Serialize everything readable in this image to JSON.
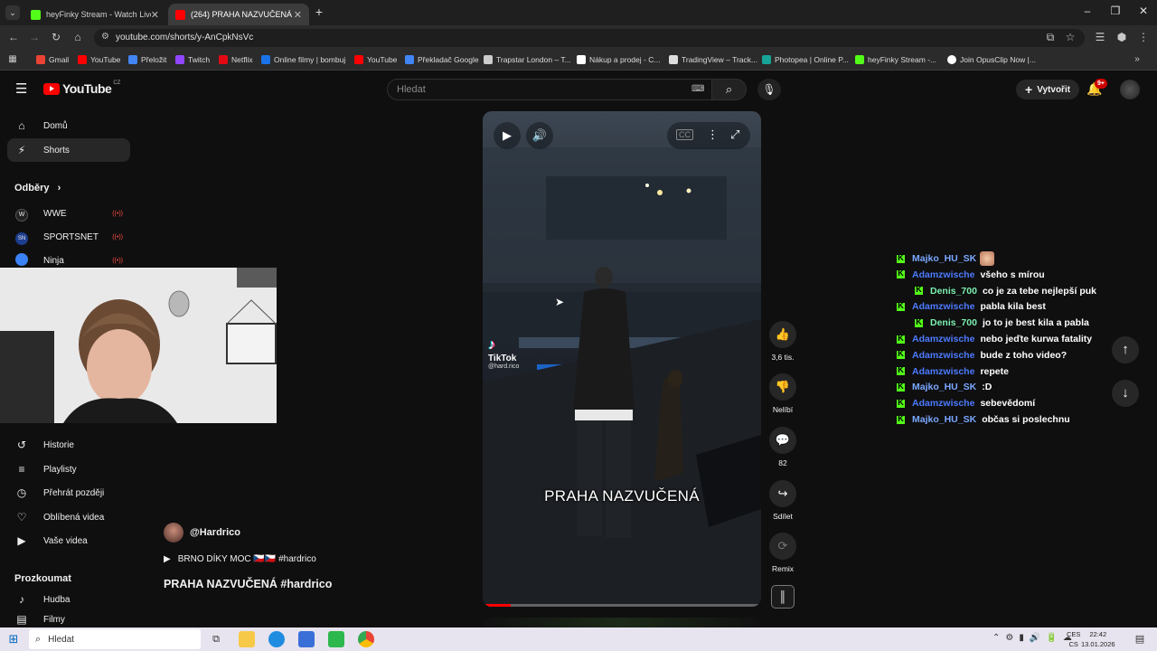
{
  "browser": {
    "tabs": [
      {
        "title": "heyFinky Stream - Watch Live o",
        "color": "#53fc18",
        "active": false
      },
      {
        "title": "(264) PRAHA NAZVUČENÁ #ha",
        "color": "#ff0000",
        "active": true
      }
    ],
    "new_tab": "+",
    "url": "youtube.com/shorts/y-AnCpkNsVc",
    "bookmarks": [
      {
        "label": "Gmail",
        "color": "#ea4335"
      },
      {
        "label": "YouTube",
        "color": "#ff0000"
      },
      {
        "label": "Přeložit",
        "color": "#4285f4"
      },
      {
        "label": "Twitch",
        "color": "#9146ff"
      },
      {
        "label": "Netflix",
        "color": "#e50914"
      },
      {
        "label": "Online filmy | bombuj",
        "color": "#1a73e8"
      },
      {
        "label": "YouTube",
        "color": "#ff0000"
      },
      {
        "label": "Překladač Google",
        "color": "#4285f4"
      },
      {
        "label": "Trapstar London – T...",
        "color": "#cccccc"
      },
      {
        "label": "Nákup a prodej - C...",
        "color": "#ffffff"
      },
      {
        "label": "TradingView – Track...",
        "color": "#dddddd"
      },
      {
        "label": "Photopea | Online P...",
        "color": "#18a497"
      },
      {
        "label": "heyFinky Stream -...",
        "color": "#53fc18"
      },
      {
        "label": "Join OpusClip Now |...",
        "color": "#ffffff"
      }
    ]
  },
  "header": {
    "logo_text": "YouTube",
    "logo_region": "CZ",
    "search_placeholder": "Hledat",
    "create_label": "Vytvořit",
    "notif_count": "9+"
  },
  "sidebar": {
    "top": [
      {
        "label": "Domů",
        "icon": "home-icon",
        "glyph": "⌂"
      },
      {
        "label": "Shorts",
        "icon": "shorts-icon",
        "glyph": "⚡"
      }
    ],
    "subs_heading": "Odběry",
    "subs": [
      {
        "label": "WWE",
        "color": "#222"
      },
      {
        "label": "SPORTSNET",
        "color": "#1d3d8f"
      },
      {
        "label": "Ninja",
        "color": "#3b82f6"
      }
    ],
    "you": [
      {
        "label": "Historie",
        "icon": "history-icon",
        "glyph": "↺"
      },
      {
        "label": "Playlisty",
        "icon": "playlist-icon",
        "glyph": "≡"
      },
      {
        "label": "Přehrát později",
        "icon": "clock-icon",
        "glyph": "◷"
      },
      {
        "label": "Oblíbená videa",
        "icon": "thumb-up-icon",
        "glyph": "👍"
      },
      {
        "label": "Vaše videa",
        "icon": "video-icon",
        "glyph": "▶"
      }
    ],
    "explore_heading": "Prozkoumat",
    "explore": [
      {
        "label": "Hudba",
        "icon": "music-icon",
        "glyph": "♪"
      },
      {
        "label": "Filmy",
        "icon": "film-icon",
        "glyph": "🎞"
      }
    ]
  },
  "player": {
    "caption": "PRAHA NAZVUČENÁ",
    "watermark_app": "TikTok",
    "watermark_handle": "@hard.rico",
    "progress": 0.1
  },
  "actions": {
    "like_count": "3,6 tis.",
    "dislike_label": "Nelíbí",
    "comments_count": "82",
    "share_label": "Sdílet",
    "remix_label": "Remix"
  },
  "channel": {
    "handle": "@Hardrico",
    "related": "BRNO DÍKY MOC 🇨🇿🇨🇿 #hardrico",
    "title": "PRAHA NAZVUČENÁ #hardrico"
  },
  "chat": [
    {
      "user": "Majko_HU_SK",
      "msg": "",
      "color": "#7aa7ff",
      "indent": false
    },
    {
      "user": "Adamzwische",
      "msg": "všeho s mírou",
      "color": "#4d7bff",
      "indent": false
    },
    {
      "user": "Denis_700",
      "msg": "co je za tebe nejlepší puk",
      "color": "#7cf0b0",
      "indent": true
    },
    {
      "user": "Adamzwische",
      "msg": "pabla kila best",
      "color": "#4d7bff",
      "indent": false
    },
    {
      "user": "Denis_700",
      "msg": "jo to je best kila a pabla",
      "color": "#7cf0b0",
      "indent": true
    },
    {
      "user": "Adamzwische",
      "msg": "nebo jeďte kurwa fatality",
      "color": "#4d7bff",
      "indent": false
    },
    {
      "user": "Adamzwische",
      "msg": "bude z toho video?",
      "color": "#4d7bff",
      "indent": false
    },
    {
      "user": "Adamzwische",
      "msg": "repete",
      "color": "#4d7bff",
      "indent": false
    },
    {
      "user": "Majko_HU_SK",
      "msg": ":D",
      "color": "#7aa7ff",
      "indent": false
    },
    {
      "user": "Adamzwische",
      "msg": "sebevědomí",
      "color": "#4d7bff",
      "indent": false
    },
    {
      "user": "Majko_HU_SK",
      "msg": "občas si poslechnu",
      "color": "#7aa7ff",
      "indent": false
    }
  ],
  "taskbar": {
    "search_placeholder": "Hledat",
    "lang_top": "CES",
    "lang_bottom": "CS",
    "time": "22:42",
    "date": "13.01.2026"
  }
}
